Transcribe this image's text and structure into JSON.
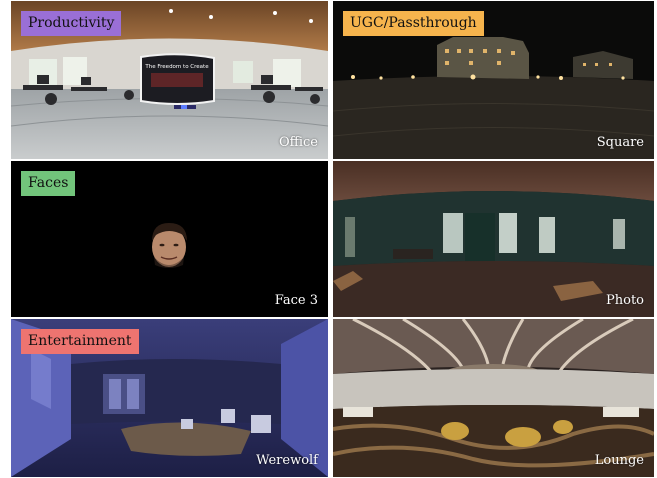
{
  "tiles": [
    {
      "category": "Productivity",
      "category_color": "#9a6fd6",
      "scene": "Office",
      "slide": {
        "title": "The Freedom to Create"
      }
    },
    {
      "category": "UGC/Passthrough",
      "category_color": "#f6b44d",
      "scene": "Square"
    },
    {
      "category": "Faces",
      "category_color": "#72c47b",
      "scene": "Face 3"
    },
    {
      "category": "",
      "category_color": "",
      "scene": "Photo"
    },
    {
      "category": "Entertainment",
      "category_color": "#ee7470",
      "scene": "Werewolf"
    },
    {
      "category": "",
      "category_color": "",
      "scene": "Lounge"
    }
  ]
}
